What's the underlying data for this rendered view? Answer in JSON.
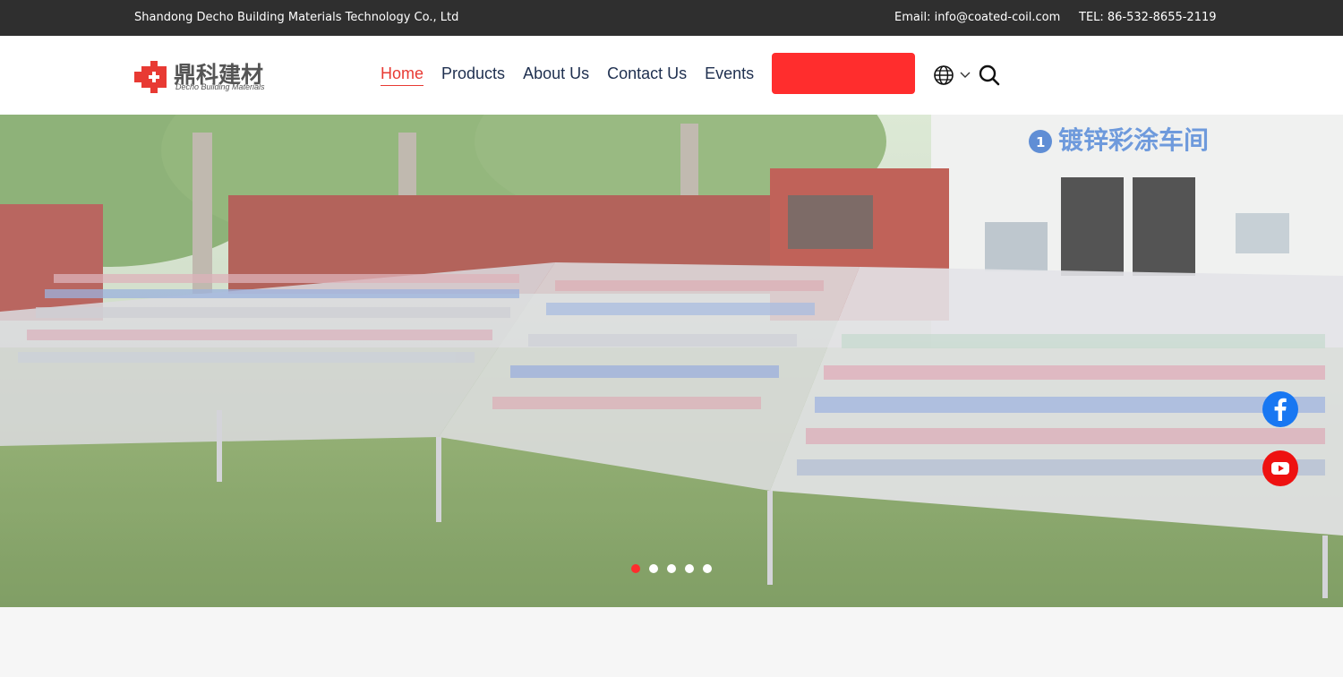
{
  "topbar": {
    "company": "Shandong Decho Building Materials Technology Co., Ltd",
    "email": "Email: info@coated-coil.com",
    "tel": "TEL: 86-532-8655-2119"
  },
  "logo": {
    "name_cn": "鼎科建材",
    "name_en": "Decho Building Materials"
  },
  "nav": {
    "items": [
      {
        "label": "Home",
        "active": true
      },
      {
        "label": "Products"
      },
      {
        "label": "About Us"
      },
      {
        "label": "Contact Us"
      },
      {
        "label": "Events"
      }
    ],
    "cta_label": "",
    "language_icon": "globe-icon",
    "search_icon": "search-icon"
  },
  "hero": {
    "sign_text": "镀锌彩涂车间",
    "sign_number": "1",
    "slides_count": 5,
    "active_slide": 1
  },
  "social": {
    "facebook_icon": "facebook-icon",
    "youtube_icon": "youtube-icon"
  },
  "colors": {
    "accent": "#ff2d2d",
    "nav_text": "#1e2f4f",
    "topbar_bg": "#2f2f2f",
    "facebook": "#1877f2",
    "youtube": "#ee1111"
  }
}
